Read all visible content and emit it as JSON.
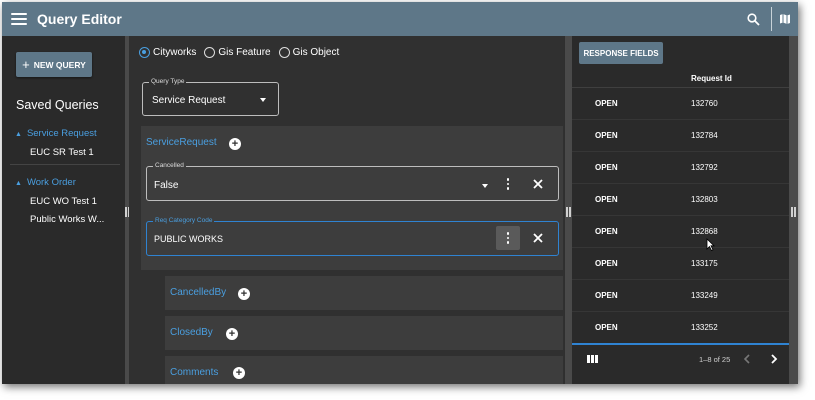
{
  "header": {
    "title": "Query Editor",
    "icons": [
      "menu-icon",
      "search-icon",
      "map-icon"
    ]
  },
  "sidebar": {
    "new_query_label": "NEW QUERY",
    "saved_title": "Saved Queries",
    "groups": [
      {
        "label": "Service Request",
        "items": [
          "EUC SR Test 1"
        ]
      },
      {
        "label": "Work Order",
        "items": [
          "EUC WO Test 1",
          "Public Works W..."
        ]
      }
    ]
  },
  "middle": {
    "radios": [
      {
        "label": "Cityworks",
        "selected": true
      },
      {
        "label": "Gis Feature",
        "selected": false
      },
      {
        "label": "Gis Object",
        "selected": false
      }
    ],
    "query_type": {
      "label": "Query Type",
      "value": "Service Request"
    },
    "panel": {
      "title": "ServiceRequest",
      "fields": [
        {
          "label": "Cancelled",
          "value": "False"
        },
        {
          "label": "Req Category Code",
          "value": "PUBLIC WORKS"
        }
      ]
    },
    "subpanels": [
      "CancelledBy",
      "ClosedBy",
      "Comments"
    ]
  },
  "right": {
    "response_fields_label": "RESPONSE FIELDS",
    "column_header": "Request Id",
    "rows": [
      {
        "status": "OPEN",
        "id": "132760"
      },
      {
        "status": "OPEN",
        "id": "132784"
      },
      {
        "status": "OPEN",
        "id": "132792"
      },
      {
        "status": "OPEN",
        "id": "132803"
      },
      {
        "status": "OPEN",
        "id": "132868"
      },
      {
        "status": "OPEN",
        "id": "133175"
      },
      {
        "status": "OPEN",
        "id": "133249"
      },
      {
        "status": "OPEN",
        "id": "133252"
      }
    ],
    "pager_text": "1–8 of 25"
  },
  "colors": {
    "header": "#5e7788",
    "accent": "#4a9fe0",
    "focus": "#2f83d2",
    "background": "#2f2f2f"
  }
}
